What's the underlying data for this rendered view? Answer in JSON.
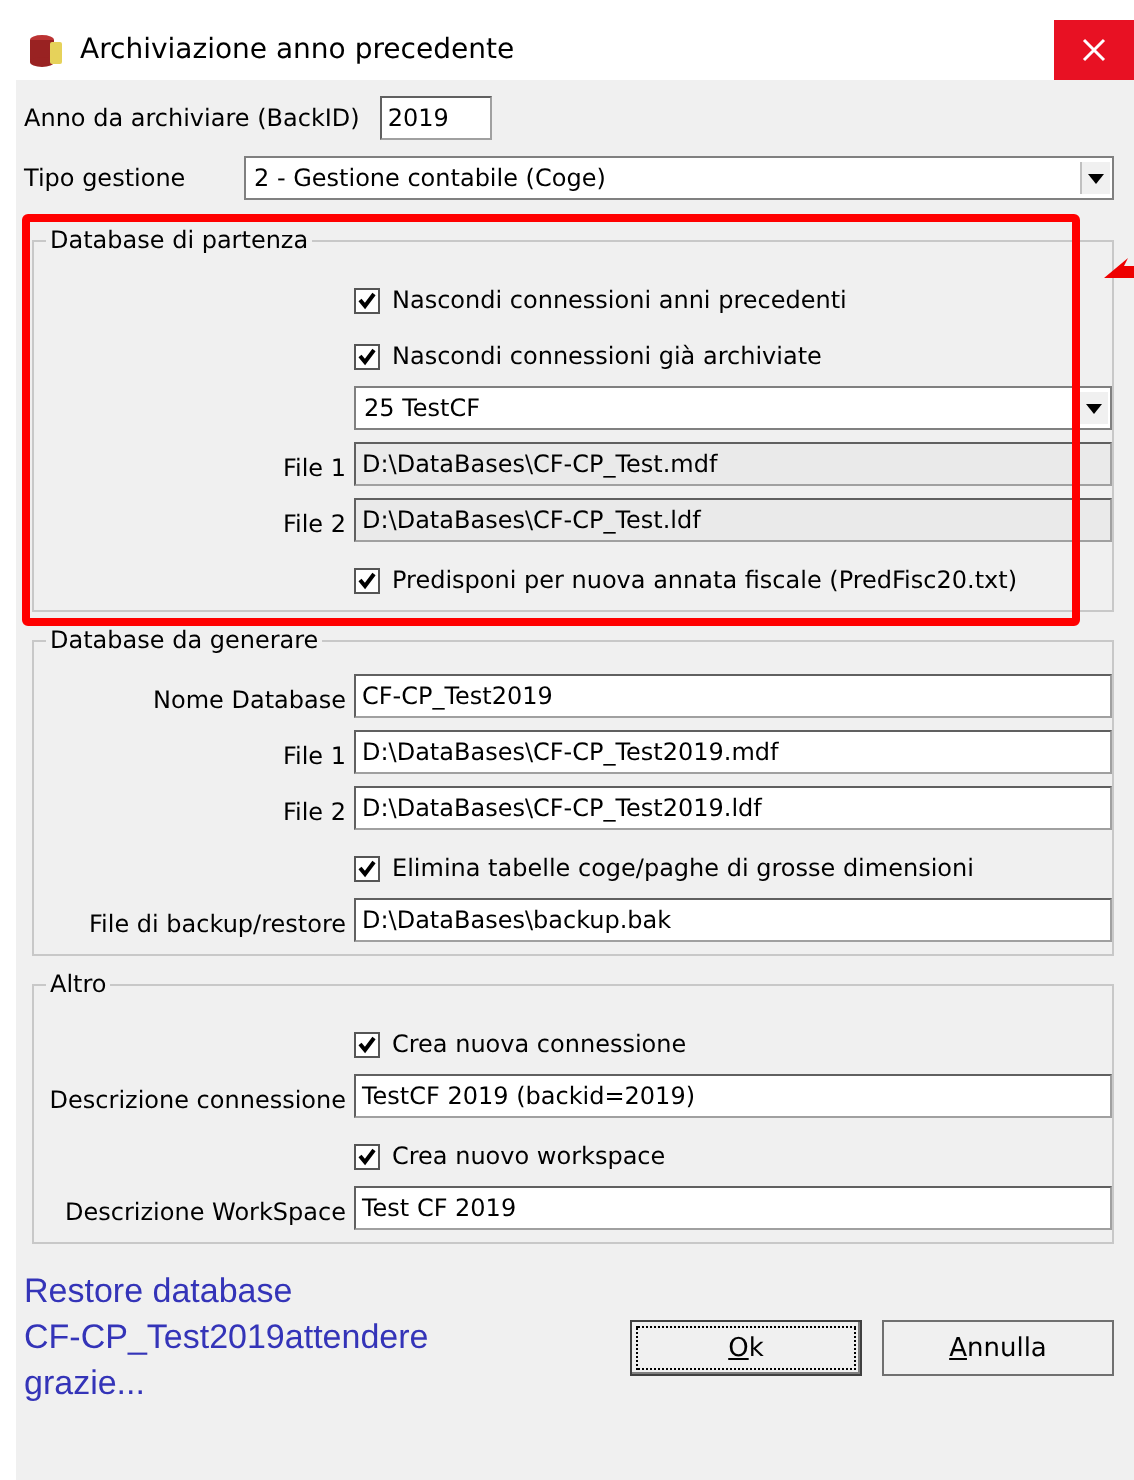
{
  "window": {
    "title": "Archiviazione anno precedente"
  },
  "year": {
    "label": "Anno da archiviare (BackID)",
    "value": "2019"
  },
  "management": {
    "label": "Tipo gestione",
    "value": "2 - Gestione contabile (Coge)"
  },
  "groups": [
    {
      "title": "Database di partenza",
      "highlighted": true,
      "rows": [
        {
          "kind": "checkbox",
          "label": "Nascondi connessioni anni precedenti",
          "checked": true
        },
        {
          "kind": "checkbox",
          "label": "Nascondi connessioni già archiviate",
          "checked": true
        },
        {
          "kind": "combo",
          "value": "25  TestCF"
        },
        {
          "kind": "field",
          "label": "File 1",
          "value": "D:\\DataBases\\CF-CP_Test.mdf",
          "readonly": true
        },
        {
          "kind": "field",
          "label": "File 2",
          "value": "D:\\DataBases\\CF-CP_Test.ldf",
          "readonly": true
        },
        {
          "kind": "checkbox",
          "label": "Predisponi per nuova annata fiscale (PredFisc20.txt)",
          "checked": true
        }
      ]
    },
    {
      "title": "Database da generare",
      "highlighted": false,
      "rows": [
        {
          "kind": "field",
          "label": "Nome Database",
          "value": "CF-CP_Test2019",
          "readonly": false
        },
        {
          "kind": "field",
          "label": "File 1",
          "value": "D:\\DataBases\\CF-CP_Test2019.mdf",
          "readonly": false
        },
        {
          "kind": "field",
          "label": "File 2",
          "value": "D:\\DataBases\\CF-CP_Test2019.ldf",
          "readonly": false
        },
        {
          "kind": "checkbox",
          "label": "Elimina tabelle coge/paghe di grosse dimensioni",
          "checked": true
        },
        {
          "kind": "field",
          "label": "File di backup/restore",
          "value": "D:\\DataBases\\backup.bak",
          "readonly": false
        }
      ]
    },
    {
      "title": "Altro",
      "highlighted": false,
      "rows": [
        {
          "kind": "checkbox",
          "label": "Crea nuova connessione",
          "checked": true
        },
        {
          "kind": "field",
          "label": "Descrizione connessione",
          "value": "TestCF 2019 (backid=2019)",
          "readonly": false
        },
        {
          "kind": "checkbox",
          "label": "Crea nuovo workspace",
          "checked": true
        },
        {
          "kind": "field",
          "label": "Descrizione WorkSpace",
          "value": "Test CF 2019",
          "readonly": false
        }
      ]
    }
  ],
  "status_lines": [
    "Restore database",
    "CF-CP_Test2019attendere",
    "grazie..."
  ],
  "buttons": [
    {
      "label": "Ok",
      "focused": true
    },
    {
      "label": "Annulla",
      "focused": false
    }
  ]
}
